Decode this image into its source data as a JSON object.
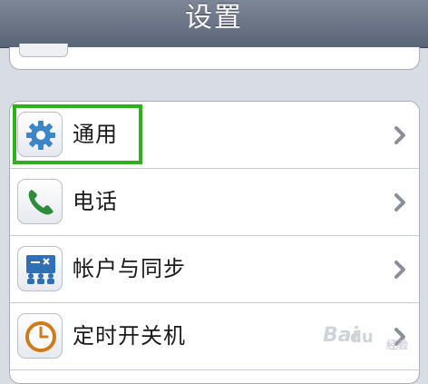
{
  "navbar": {
    "title": "设置"
  },
  "settings": {
    "items": [
      {
        "label": "通用",
        "icon": "gear-icon"
      },
      {
        "label": "电话",
        "icon": "phone-icon"
      },
      {
        "label": "帐户与同步",
        "icon": "account-sync-icon"
      },
      {
        "label": "定时开关机",
        "icon": "clock-icon"
      }
    ],
    "chevron_icon": "chevron-right-icon"
  },
  "annotation": {
    "highlight_color": "#2fb01d"
  },
  "watermark": {
    "text": "Bai",
    "paw": "du",
    "sub": "经验"
  }
}
